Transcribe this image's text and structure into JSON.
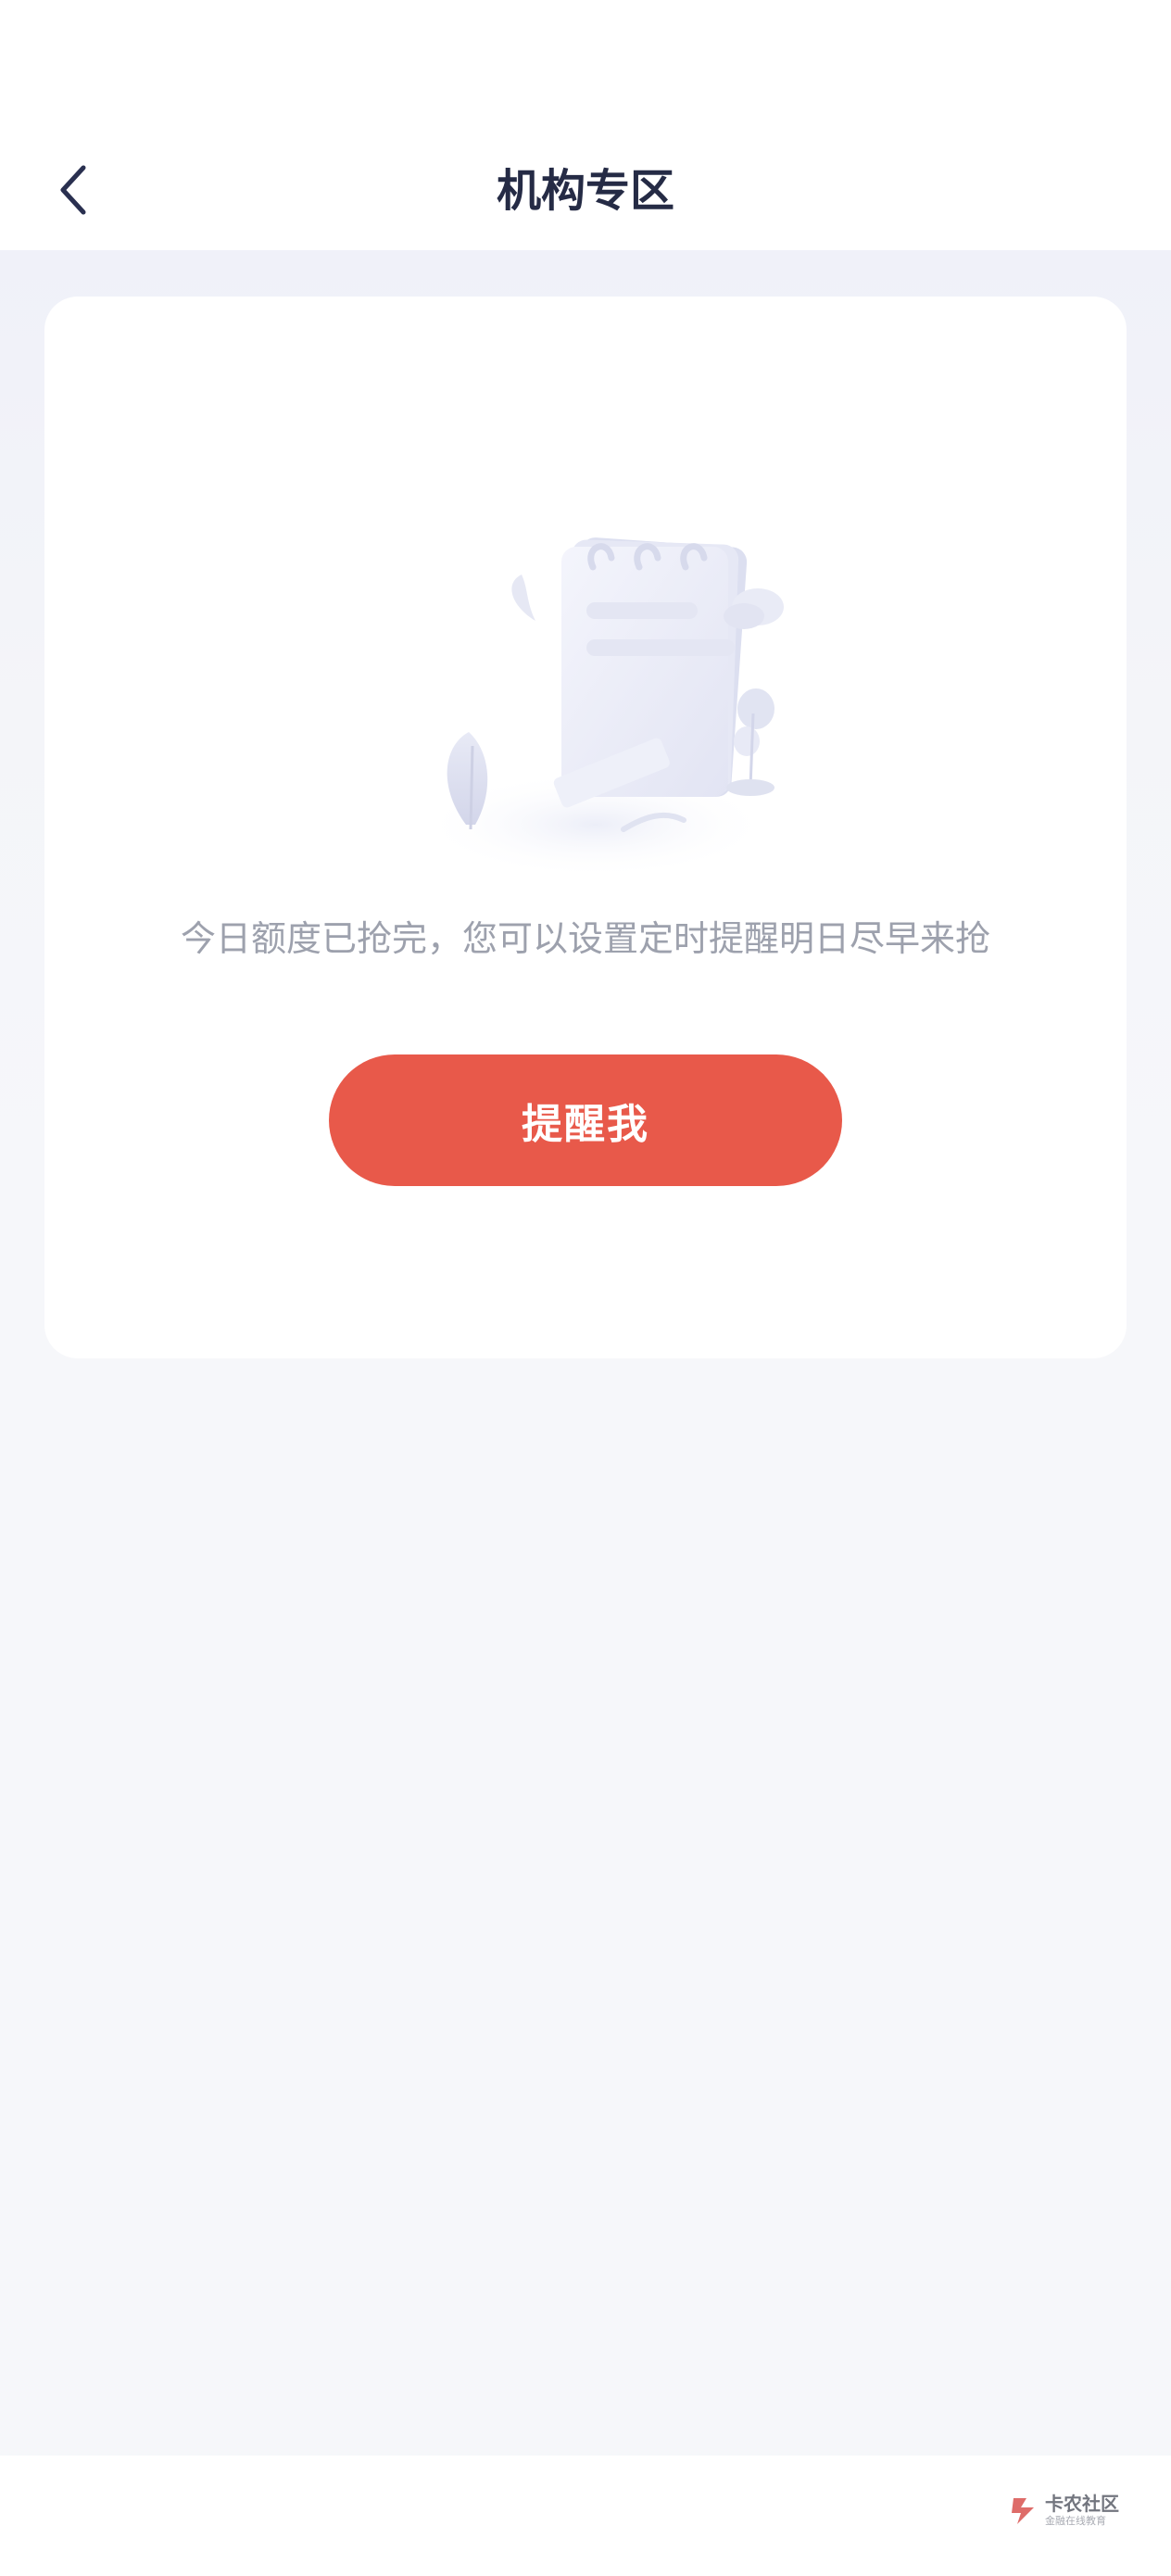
{
  "header": {
    "title": "机构专区",
    "back_icon": "chevron-left-icon"
  },
  "card": {
    "illustration": "empty-notepad-illustration",
    "message": "今日额度已抢完，您可以设置定时提醒明日尽早来抢",
    "button_label": "提醒我"
  },
  "colors": {
    "accent": "#e8594a",
    "title": "#252b45",
    "message": "#9da1ad",
    "page_background": "#f6f7fa",
    "card_background": "#ffffff"
  },
  "watermark": {
    "title": "卡农社区",
    "subtitle": "金融在线教育"
  }
}
